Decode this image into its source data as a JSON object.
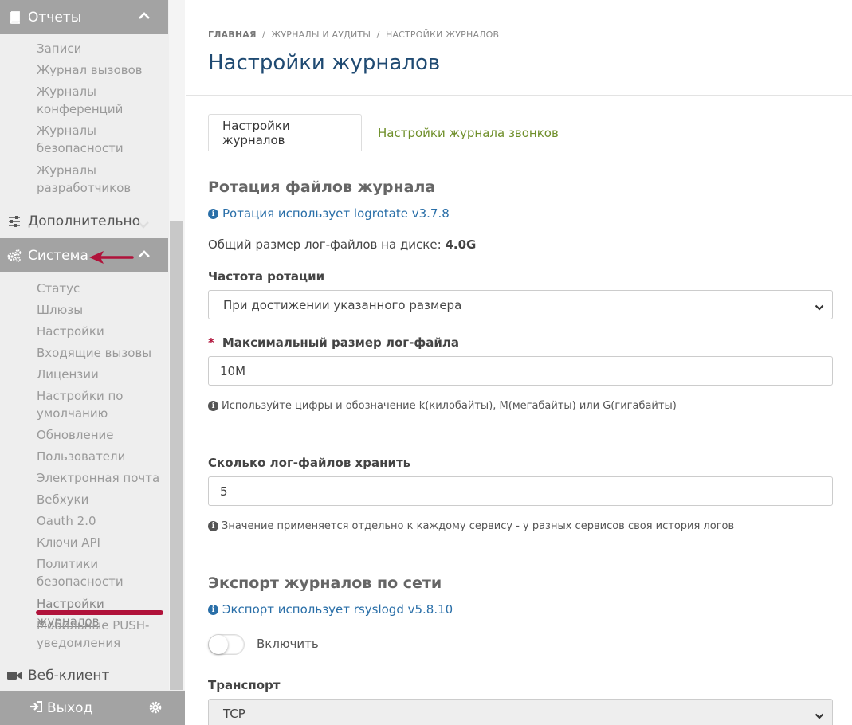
{
  "sidebar": {
    "reports_header": "Отчеты",
    "reports_items": [
      "Записи",
      "Журнал вызовов",
      "Журналы\nконференций",
      "Журналы\nбезопасности",
      "Журналы\nразработчиков"
    ],
    "advanced": "Дополнительно",
    "system_header": "Система",
    "system_items": [
      "Статус",
      "Шлюзы",
      "Настройки",
      "Входящие вызовы",
      "Лицензии",
      "Настройки по\nумолчанию",
      "Обновление",
      "Пользователи",
      "Электронная почта",
      "Вебхуки",
      "Oauth 2.0",
      "Ключи API",
      "Политики\nбезопасности",
      "Настройки журналов",
      "Мобильные PUSH-\nуведомления"
    ],
    "active_item": "Настройки журналов",
    "web_client": "Веб-клиент",
    "logout": "Выход"
  },
  "breadcrumb": {
    "home": "ГЛАВНАЯ",
    "sep": "/",
    "level1": "ЖУРНАЛЫ И АУДИТЫ",
    "level2": "НАСТРОЙКИ ЖУРНАЛОВ"
  },
  "page_title": "Настройки журналов",
  "tabs": {
    "active": "Настройки журналов",
    "inactive": "Настройки журнала звонков"
  },
  "rotation": {
    "title": "Ротация файлов журнала",
    "info": "Ротация использует logrotate v3.7.8",
    "disk_label": "Общий размер лог-файлов на диске:",
    "disk_value": "4.0G",
    "freq_label": "Частота ротации",
    "freq_value": "При достижении указанного размера",
    "required_mark": "*",
    "max_label": "Максимальный размер лог-файла",
    "max_value": "10M",
    "max_help": "Используйте цифры и обозначение k(килобайты), M(мегабайты) или G(гигабайты)",
    "keep_label": "Сколько лог-файлов хранить",
    "keep_value": "5",
    "keep_help": "Значение применяется отдельно к каждому сервису - у разных сервисов своя история логов"
  },
  "export": {
    "title": "Экспорт журналов по сети",
    "info": "Экспорт использует rsyslogd v5.8.10",
    "toggle_label": "Включить",
    "toggle_on": false,
    "transport_label": "Транспорт",
    "transport_value": "TCP"
  },
  "colors": {
    "title_blue": "#1f4a72",
    "link_blue": "#2a6fa8",
    "tab_green": "#6f8f2a",
    "annotation_red": "#b0123a",
    "sidebar_header_gray": "#a3a3a3"
  }
}
